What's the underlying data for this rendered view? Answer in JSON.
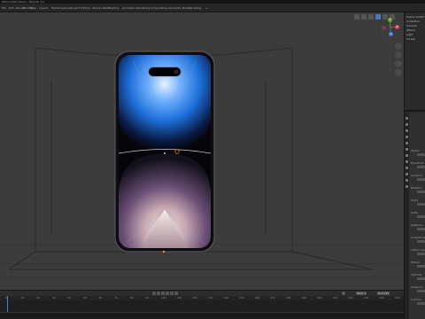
{
  "window": {
    "title": "iPhone14Pro.blend - Blender 4.0"
  },
  "menu": {
    "items": [
      "File",
      "Edit",
      "Render",
      "Window",
      "Help",
      "Layout",
      "Modeling",
      "Sculpting",
      "UV Editing",
      "Texture Paint",
      "Shading",
      "Animation",
      "Rendering",
      "Compositing",
      "Geometry Nodes",
      "Scripting",
      "+"
    ]
  },
  "viewport": {
    "tools": [
      "viewpoint-icon",
      "overlay-icon",
      "xray-icon",
      "solid-shading-icon",
      "material-shading-icon",
      "render-shading-icon"
    ],
    "gizmo": {
      "x": "X",
      "y": "Y",
      "z": "Z"
    },
    "nav_buttons": [
      "zoom-icon",
      "hand-icon",
      "camera-view-icon",
      "ortho-toggle-icon"
    ]
  },
  "outliner": {
    "rows": [
      "Scene Collection",
      "Collection",
      "Camera",
      "iPhone",
      "Light",
      "Screen"
    ]
  },
  "properties": {
    "rows": [
      "Object",
      "Transform",
      "Location",
      "Rotation",
      "Scale",
      "Delta",
      "Relations",
      "Collections",
      "Instancing",
      "Motion",
      "Visibility",
      "Viewport",
      "Custom"
    ]
  },
  "timeline": {
    "current_frame": "1",
    "start_label": "Start",
    "start": "1",
    "end_label": "End",
    "end": "250",
    "ticks": [
      "0",
      "10",
      "20",
      "30",
      "40",
      "50",
      "60",
      "70",
      "80",
      "90",
      "100",
      "110",
      "120",
      "130",
      "140",
      "150",
      "160",
      "170",
      "180",
      "190",
      "200",
      "210",
      "220",
      "230",
      "240",
      "250"
    ]
  },
  "colors": {
    "accent": "#4d77b3",
    "x_axis": "#d4495e",
    "y_axis": "#6ea42a",
    "z_axis": "#3f74d6",
    "viewport_bg": "#3b3b3b",
    "phone_frame": "#1a1a1f",
    "screen_blue": "#1d6fd8"
  }
}
